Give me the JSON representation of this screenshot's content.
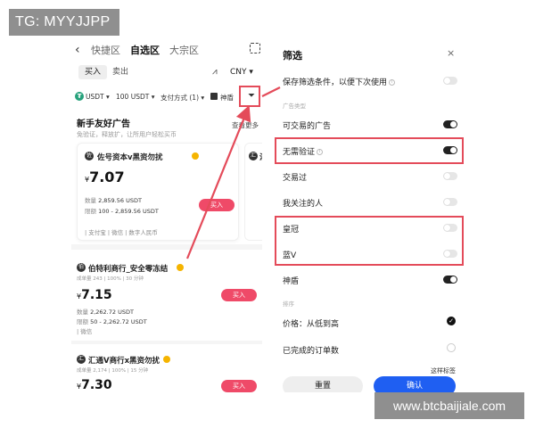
{
  "overlays": {
    "tg_badge": "TG: MYYJJPP",
    "watermark": "www.btcbaijiale.com"
  },
  "left_panel": {
    "nav": {
      "back_icon": "‹",
      "tabs": [
        "快捷区",
        "自选区",
        "大宗区"
      ],
      "active_tab": "自选区"
    },
    "side_tabs": {
      "buy": "买入",
      "sell": "卖出"
    },
    "currency": "CNY ▾",
    "filter_bar": {
      "coin": "USDT ▾",
      "amount": "100 USDT ▾",
      "payment": "支付方式 (1) ▾",
      "shield": "神盾"
    },
    "newbie": {
      "title": "新手友好广告",
      "subtitle": "免验证，释放扩，让所用户轻松买币",
      "view_more": "查看更多"
    },
    "card1": {
      "merchant": "佐号资本v黑资勿扰",
      "price_currency": "¥",
      "price": "7.07",
      "quantity_label": "数量",
      "quantity": "2,859.56 USDT",
      "limit_label": "限额",
      "limit": "100 - 2,859.56 USDT",
      "buy": "买入",
      "pay_tags": "| 支付宝  | 微信  | 数字人民币"
    },
    "card2": {
      "merchant_prefix": "汇"
    },
    "list": [
      {
        "merchant": "伯特利商行_安全零冻结",
        "stats": "成单量 243  |  100%  |  30 分钟",
        "price_currency": "¥",
        "price": "7.15",
        "quantity_label": "数量",
        "quantity": "2,262.72 USDT",
        "limit_label": "限额",
        "limit": "50 - 2,262.72 USDT",
        "buy": "买入",
        "pay_tags": "| 微信"
      },
      {
        "merchant": "汇通V商行x黑资勿扰",
        "stats": "成单量 2,174  |  100%  |  15 分钟",
        "price_currency": "¥",
        "price": "7.30",
        "buy": "买入"
      }
    ]
  },
  "right_panel": {
    "title": "筛选",
    "close": "×",
    "save_filter": {
      "label": "保存筛选条件，以便下次使用",
      "on": false
    },
    "ad_type_section": "广告类型",
    "rows": [
      {
        "label": "可交易的广告",
        "on": true
      },
      {
        "label": "无需验证",
        "on": true,
        "info": true
      },
      {
        "label": "交易过",
        "on": false
      },
      {
        "label": "我关注的人",
        "on": false
      },
      {
        "label": "皇冠",
        "on": false
      },
      {
        "label": "蓝V",
        "on": false
      },
      {
        "label": "神盾",
        "on": true
      }
    ],
    "sort_section": "排序",
    "sort_options": [
      {
        "label": "价格：从低到高",
        "selected": true
      },
      {
        "label": "已完成的订单数",
        "selected": false
      }
    ],
    "bottom_text": "这样标签",
    "reset": "重置",
    "confirm": "确认"
  },
  "colors": {
    "highlight": "#e44b5a",
    "confirm_button": "#1f5ff2",
    "buy_button": "#ef4a68",
    "toggle_on": "#222222"
  }
}
